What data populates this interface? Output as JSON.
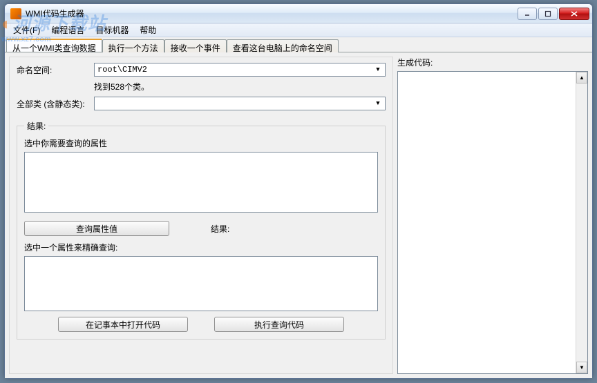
{
  "window": {
    "title": "WMI代码生成器"
  },
  "menu": {
    "file": "文件(F)",
    "language": "编程语言",
    "target": "目标机器",
    "help": "帮助"
  },
  "tabs": {
    "t1": "从一个WMI类查询数据",
    "t2": "执行一个方法",
    "t3": "接收一个事件",
    "t4": "查看这台电脑上的命名空间"
  },
  "left": {
    "namespace_label": "命名空间:",
    "namespace_value": "root\\CIMV2",
    "found_hint": "找到528个类。",
    "allclass_label": "全部类 (含静态类):",
    "allclass_value": "",
    "results_legend": "结果:",
    "select_props": "选中你需要查询的属性",
    "query_prop_btn": "查询属性值",
    "results_label2": "结果:",
    "select_one_prop": "选中一个属性来精确查询:",
    "open_notepad_btn": "在记事本中打开代码",
    "exec_query_btn": "执行查询代码"
  },
  "right": {
    "gen_code_label": "生成代码:"
  },
  "watermark": {
    "main": "河源下载站",
    "sub": "www.xz7.com"
  }
}
